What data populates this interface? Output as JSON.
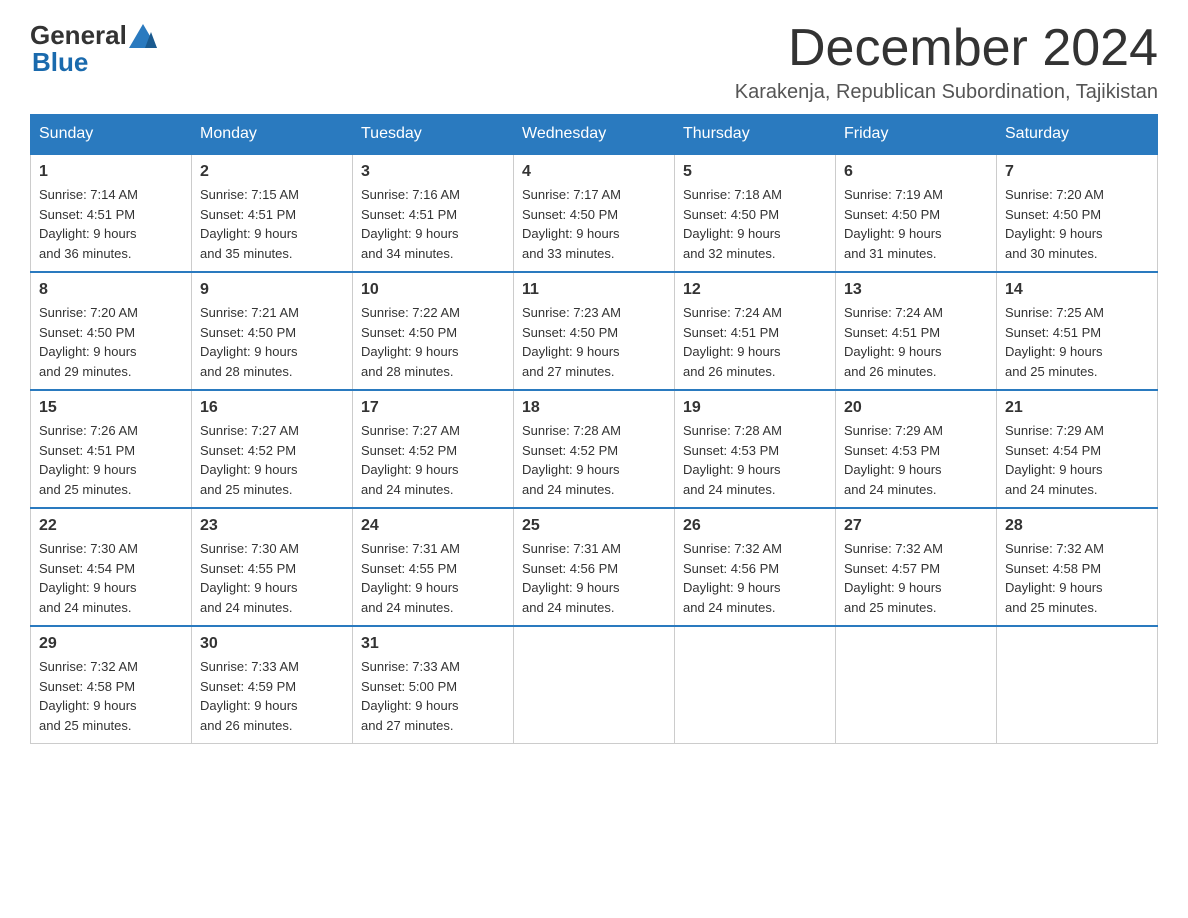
{
  "header": {
    "logo_general": "General",
    "logo_blue": "Blue",
    "month_title": "December 2024",
    "subtitle": "Karakenja, Republican Subordination, Tajikistan"
  },
  "weekdays": [
    "Sunday",
    "Monday",
    "Tuesday",
    "Wednesday",
    "Thursday",
    "Friday",
    "Saturday"
  ],
  "weeks": [
    [
      {
        "day": "1",
        "sunrise": "7:14 AM",
        "sunset": "4:51 PM",
        "daylight": "9 hours and 36 minutes."
      },
      {
        "day": "2",
        "sunrise": "7:15 AM",
        "sunset": "4:51 PM",
        "daylight": "9 hours and 35 minutes."
      },
      {
        "day": "3",
        "sunrise": "7:16 AM",
        "sunset": "4:51 PM",
        "daylight": "9 hours and 34 minutes."
      },
      {
        "day": "4",
        "sunrise": "7:17 AM",
        "sunset": "4:50 PM",
        "daylight": "9 hours and 33 minutes."
      },
      {
        "day": "5",
        "sunrise": "7:18 AM",
        "sunset": "4:50 PM",
        "daylight": "9 hours and 32 minutes."
      },
      {
        "day": "6",
        "sunrise": "7:19 AM",
        "sunset": "4:50 PM",
        "daylight": "9 hours and 31 minutes."
      },
      {
        "day": "7",
        "sunrise": "7:20 AM",
        "sunset": "4:50 PM",
        "daylight": "9 hours and 30 minutes."
      }
    ],
    [
      {
        "day": "8",
        "sunrise": "7:20 AM",
        "sunset": "4:50 PM",
        "daylight": "9 hours and 29 minutes."
      },
      {
        "day": "9",
        "sunrise": "7:21 AM",
        "sunset": "4:50 PM",
        "daylight": "9 hours and 28 minutes."
      },
      {
        "day": "10",
        "sunrise": "7:22 AM",
        "sunset": "4:50 PM",
        "daylight": "9 hours and 28 minutes."
      },
      {
        "day": "11",
        "sunrise": "7:23 AM",
        "sunset": "4:50 PM",
        "daylight": "9 hours and 27 minutes."
      },
      {
        "day": "12",
        "sunrise": "7:24 AM",
        "sunset": "4:51 PM",
        "daylight": "9 hours and 26 minutes."
      },
      {
        "day": "13",
        "sunrise": "7:24 AM",
        "sunset": "4:51 PM",
        "daylight": "9 hours and 26 minutes."
      },
      {
        "day": "14",
        "sunrise": "7:25 AM",
        "sunset": "4:51 PM",
        "daylight": "9 hours and 25 minutes."
      }
    ],
    [
      {
        "day": "15",
        "sunrise": "7:26 AM",
        "sunset": "4:51 PM",
        "daylight": "9 hours and 25 minutes."
      },
      {
        "day": "16",
        "sunrise": "7:27 AM",
        "sunset": "4:52 PM",
        "daylight": "9 hours and 25 minutes."
      },
      {
        "day": "17",
        "sunrise": "7:27 AM",
        "sunset": "4:52 PM",
        "daylight": "9 hours and 24 minutes."
      },
      {
        "day": "18",
        "sunrise": "7:28 AM",
        "sunset": "4:52 PM",
        "daylight": "9 hours and 24 minutes."
      },
      {
        "day": "19",
        "sunrise": "7:28 AM",
        "sunset": "4:53 PM",
        "daylight": "9 hours and 24 minutes."
      },
      {
        "day": "20",
        "sunrise": "7:29 AM",
        "sunset": "4:53 PM",
        "daylight": "9 hours and 24 minutes."
      },
      {
        "day": "21",
        "sunrise": "7:29 AM",
        "sunset": "4:54 PM",
        "daylight": "9 hours and 24 minutes."
      }
    ],
    [
      {
        "day": "22",
        "sunrise": "7:30 AM",
        "sunset": "4:54 PM",
        "daylight": "9 hours and 24 minutes."
      },
      {
        "day": "23",
        "sunrise": "7:30 AM",
        "sunset": "4:55 PM",
        "daylight": "9 hours and 24 minutes."
      },
      {
        "day": "24",
        "sunrise": "7:31 AM",
        "sunset": "4:55 PM",
        "daylight": "9 hours and 24 minutes."
      },
      {
        "day": "25",
        "sunrise": "7:31 AM",
        "sunset": "4:56 PM",
        "daylight": "9 hours and 24 minutes."
      },
      {
        "day": "26",
        "sunrise": "7:32 AM",
        "sunset": "4:56 PM",
        "daylight": "9 hours and 24 minutes."
      },
      {
        "day": "27",
        "sunrise": "7:32 AM",
        "sunset": "4:57 PM",
        "daylight": "9 hours and 25 minutes."
      },
      {
        "day": "28",
        "sunrise": "7:32 AM",
        "sunset": "4:58 PM",
        "daylight": "9 hours and 25 minutes."
      }
    ],
    [
      {
        "day": "29",
        "sunrise": "7:32 AM",
        "sunset": "4:58 PM",
        "daylight": "9 hours and 25 minutes."
      },
      {
        "day": "30",
        "sunrise": "7:33 AM",
        "sunset": "4:59 PM",
        "daylight": "9 hours and 26 minutes."
      },
      {
        "day": "31",
        "sunrise": "7:33 AM",
        "sunset": "5:00 PM",
        "daylight": "9 hours and 27 minutes."
      },
      null,
      null,
      null,
      null
    ]
  ]
}
